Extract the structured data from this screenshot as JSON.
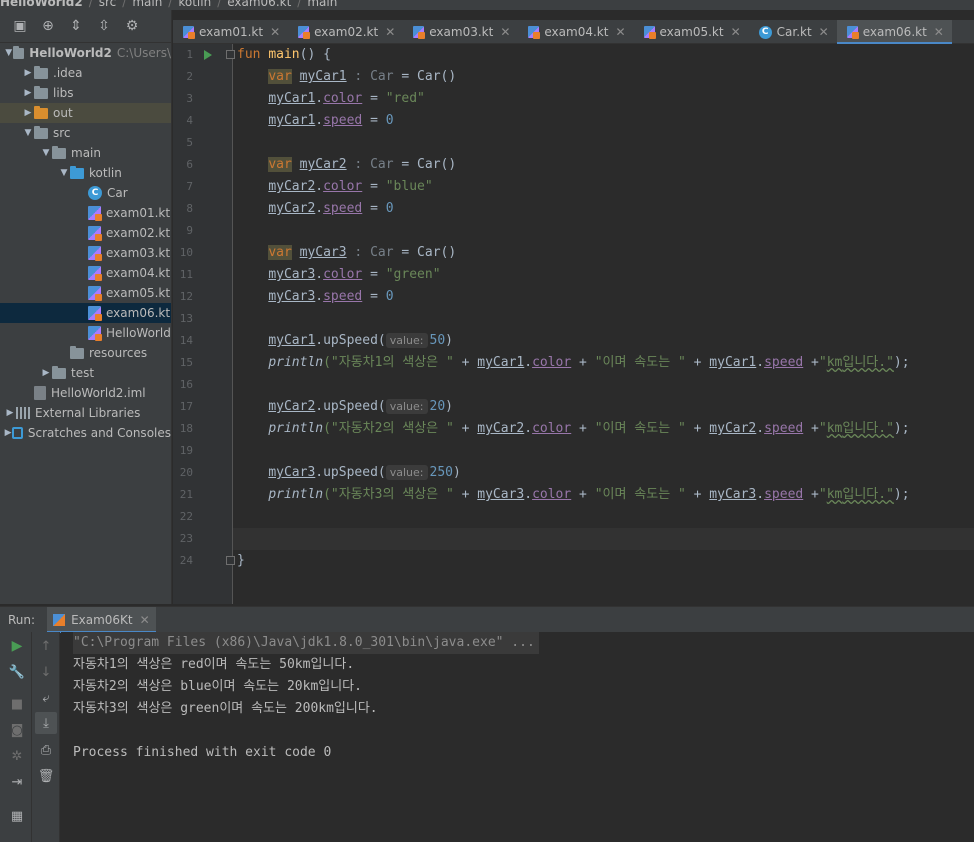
{
  "breadcrumb": {
    "items": [
      "HelloWorld2",
      "src",
      "main",
      "kotlin",
      "exam06.kt",
      "main"
    ]
  },
  "project_panel": {
    "tree": [
      {
        "label": "HelloWorld2",
        "extra": "C:\\Users\\",
        "icon": "folder",
        "depth": 0,
        "arrow": "down",
        "bold": true
      },
      {
        "label": ".idea",
        "icon": "folder",
        "depth": 1,
        "arrow": "right"
      },
      {
        "label": "libs",
        "icon": "folder",
        "depth": 1,
        "arrow": "right"
      },
      {
        "label": "out",
        "icon": "folder-orange",
        "depth": 1,
        "arrow": "right",
        "highlight": true
      },
      {
        "label": "src",
        "icon": "folder",
        "depth": 1,
        "arrow": "down"
      },
      {
        "label": "main",
        "icon": "folder",
        "depth": 2,
        "arrow": "down"
      },
      {
        "label": "kotlin",
        "icon": "folder-blue",
        "depth": 3,
        "arrow": "down"
      },
      {
        "label": "Car",
        "icon": "class",
        "depth": 4
      },
      {
        "label": "exam01.kt",
        "icon": "kt",
        "depth": 4
      },
      {
        "label": "exam02.kt",
        "icon": "kt",
        "depth": 4
      },
      {
        "label": "exam03.kt",
        "icon": "kt",
        "depth": 4
      },
      {
        "label": "exam04.kt",
        "icon": "kt",
        "depth": 4
      },
      {
        "label": "exam05.kt",
        "icon": "kt",
        "depth": 4
      },
      {
        "label": "exam06.kt",
        "icon": "kt",
        "depth": 4,
        "selected": true
      },
      {
        "label": "HelloWorld",
        "icon": "kt",
        "depth": 4
      },
      {
        "label": "resources",
        "icon": "folder",
        "depth": 3
      },
      {
        "label": "test",
        "icon": "folder",
        "depth": 2,
        "arrow": "right"
      },
      {
        "label": "HelloWorld2.iml",
        "icon": "iml",
        "depth": 1
      },
      {
        "label": "External Libraries",
        "icon": "lib",
        "depth": 0,
        "arrow": "right"
      },
      {
        "label": "Scratches and Consoles",
        "icon": "scratch",
        "depth": 0,
        "arrow": "right"
      }
    ]
  },
  "tabs": [
    {
      "label": "exam01.kt",
      "icon": "kt"
    },
    {
      "label": "exam02.kt",
      "icon": "kt"
    },
    {
      "label": "exam03.kt",
      "icon": "kt"
    },
    {
      "label": "exam04.kt",
      "icon": "kt"
    },
    {
      "label": "exam05.kt",
      "icon": "kt"
    },
    {
      "label": "Car.kt",
      "icon": "class"
    },
    {
      "label": "exam06.kt",
      "icon": "kt",
      "active": true
    }
  ],
  "editor": {
    "line_numbers": [
      "1",
      "2",
      "3",
      "4",
      "5",
      "6",
      "7",
      "8",
      "9",
      "10",
      "11",
      "12",
      "13",
      "14",
      "15",
      "16",
      "17",
      "18",
      "19",
      "20",
      "21",
      "22",
      "23",
      "24"
    ],
    "tokens": {
      "fun": "fun",
      "main": "main",
      "parens_open": "() {",
      "var": "var",
      "colon_car": " : Car",
      "eq_car": " = Car()",
      "car1": "myCar1",
      "car2": "myCar2",
      "car3": "myCar3",
      "color": "color",
      "speed": "speed",
      "red": "\"red\"",
      "blue": "\"blue\"",
      "green": "\"green\"",
      "zero": "0",
      "upspeed": ".upSpeed(",
      "hint": "value:",
      "v50": "50",
      "v20": "20",
      "v250": "250",
      "println": "println",
      "s1": "(\"자동차1의 색상은 \"",
      "s2": "(\"자동차2의 색상은 \"",
      "s3": "(\"자동차3의 색상은 \"",
      "mid": "\"이며 속도는 \"",
      "km": "km",
      "nida": "입니다.\"",
      "close_brace": "}"
    }
  },
  "run_panel": {
    "label": "Run:",
    "tab_label": "Exam06Kt",
    "console": [
      "\"C:\\Program Files (x86)\\Java\\jdk1.8.0_301\\bin\\java.exe\" ...",
      "자동차1의 색상은 red이며 속도는 50km입니다.",
      "자동차2의 색상은 blue이며 속도는 20km입니다.",
      "자동차3의 색상은 green이며 속도는 200km입니다.",
      "",
      "Process finished with exit code 0"
    ]
  },
  "colors": {
    "keyword": "#cc7832",
    "string": "#6a8759",
    "number": "#6897bb",
    "property": "#9876aa",
    "accent": "#4a88c7"
  }
}
